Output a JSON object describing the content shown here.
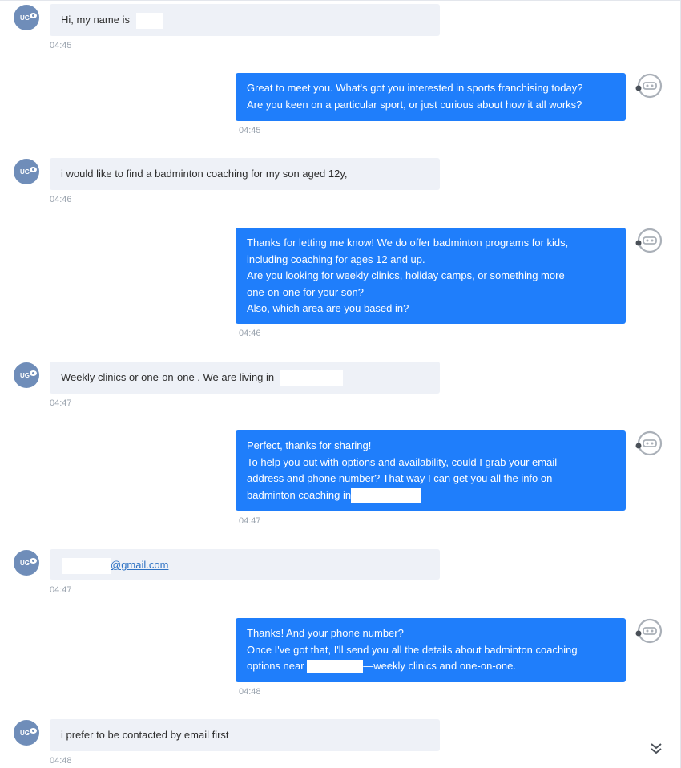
{
  "colors": {
    "accent": "#1f7efb",
    "incoming_bg": "#eef1f7",
    "avatar": "#6f8db9"
  },
  "user_avatar": {
    "initials": "UG",
    "icon": "chat-bubble-icon"
  },
  "bot_avatar": {
    "icon": "robot-face-icon"
  },
  "messages": [
    {
      "from": "user",
      "text": "Hi, my name is",
      "time": "04:45"
    },
    {
      "from": "bot",
      "lines": [
        "Great to meet you. What's got you interested in sports franchising today?",
        "Are you keen on a particular sport, or just curious about how it all works?"
      ],
      "time": "04:45"
    },
    {
      "from": "user",
      "text": "i would like to find a badminton coaching for my son aged 12y,",
      "time": "04:46"
    },
    {
      "from": "bot",
      "lines": [
        "Thanks for letting me know! We do offer badminton programs for kids,",
        "including coaching for ages 12 and up.",
        "Are you looking for weekly clinics, holiday camps, or something more",
        "one-on-one for your son?",
        "Also, which area are you based in?"
      ],
      "time": "04:46"
    },
    {
      "from": "user",
      "text": "Weekly clinics or one-on-one . We are living in",
      "time": "04:47"
    },
    {
      "from": "bot",
      "lines": [
        "Perfect, thanks for sharing!",
        "To help you out with options and availability, could I grab your email",
        "address and phone number? That way I can get you all the info on",
        "badminton coaching in"
      ],
      "time": "04:47"
    },
    {
      "from": "user",
      "email_domain": "@gmail.com",
      "time": "04:47"
    },
    {
      "from": "bot",
      "lines": [
        "Thanks! And your phone number?",
        "Once I've got that, I'll send you all the details about badminton coaching",
        "options near"
      ],
      "line3_suffix": "—weekly clinics and one-on-one.",
      "time": "04:48"
    },
    {
      "from": "user",
      "text": "i prefer to be contacted by email first",
      "time": "04:48"
    }
  ],
  "scroll_button": {
    "icon": "double-chevron-down-icon"
  }
}
